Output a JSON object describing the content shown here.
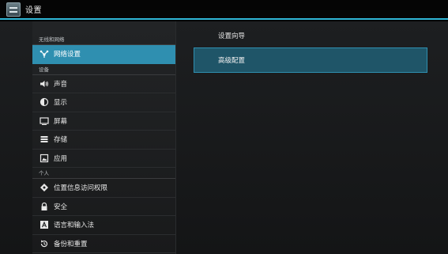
{
  "window": {
    "title": "设置",
    "icon": "settings-app-icon"
  },
  "sidebar": {
    "sections": [
      {
        "header": "无线和网络",
        "items": [
          {
            "label": "网络设置",
            "icon": "network-icon",
            "selected": true
          }
        ]
      },
      {
        "header": "设备",
        "items": [
          {
            "label": "声音",
            "icon": "speaker-icon"
          },
          {
            "label": "显示",
            "icon": "brightness-icon"
          },
          {
            "label": "屏幕",
            "icon": "monitor-icon"
          },
          {
            "label": "存储",
            "icon": "storage-icon"
          },
          {
            "label": "应用",
            "icon": "apps-icon"
          }
        ]
      },
      {
        "header": "个人",
        "items": [
          {
            "label": "位置信息访问权限",
            "icon": "location-icon"
          },
          {
            "label": "安全",
            "icon": "lock-icon"
          },
          {
            "label": "语言和输入法",
            "icon": "language-icon"
          },
          {
            "label": "备份和重置",
            "icon": "backup-icon"
          }
        ]
      }
    ]
  },
  "content": {
    "items": [
      {
        "label": "设置向导",
        "highlighted": false
      },
      {
        "label": "高级配置",
        "highlighted": true
      }
    ]
  },
  "colors": {
    "accent": "#2f8fb0",
    "titlebar_line": "#2fb6d6",
    "highlight_box": "#1f5568"
  }
}
